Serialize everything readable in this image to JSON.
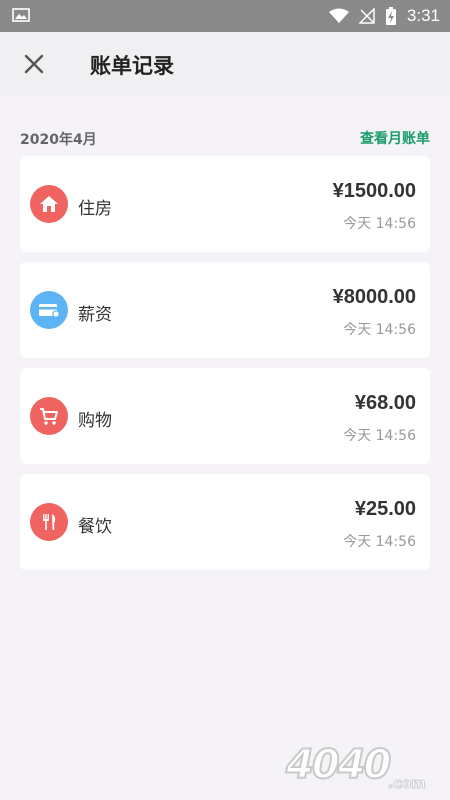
{
  "status_bar": {
    "time": "3:31"
  },
  "header": {
    "title": "账单记录"
  },
  "month": {
    "label": "2020年4月",
    "link": "查看月账单"
  },
  "records": [
    {
      "category": "住房",
      "icon": "home-icon",
      "color": "#ef6461",
      "amount": "¥1500.00",
      "time": "今天 14:56"
    },
    {
      "category": "薪资",
      "icon": "wallet-card-icon",
      "color": "#5db4f5",
      "amount": "¥8000.00",
      "time": "今天 14:56"
    },
    {
      "category": "购物",
      "icon": "shopping-cart-icon",
      "color": "#ef6461",
      "amount": "¥68.00",
      "time": "今天 14:56"
    },
    {
      "category": "餐饮",
      "icon": "fork-knife-icon",
      "color": "#ef6461",
      "amount": "¥25.00",
      "time": "今天 14:56"
    }
  ],
  "watermark": {
    "text": "4040.com"
  }
}
